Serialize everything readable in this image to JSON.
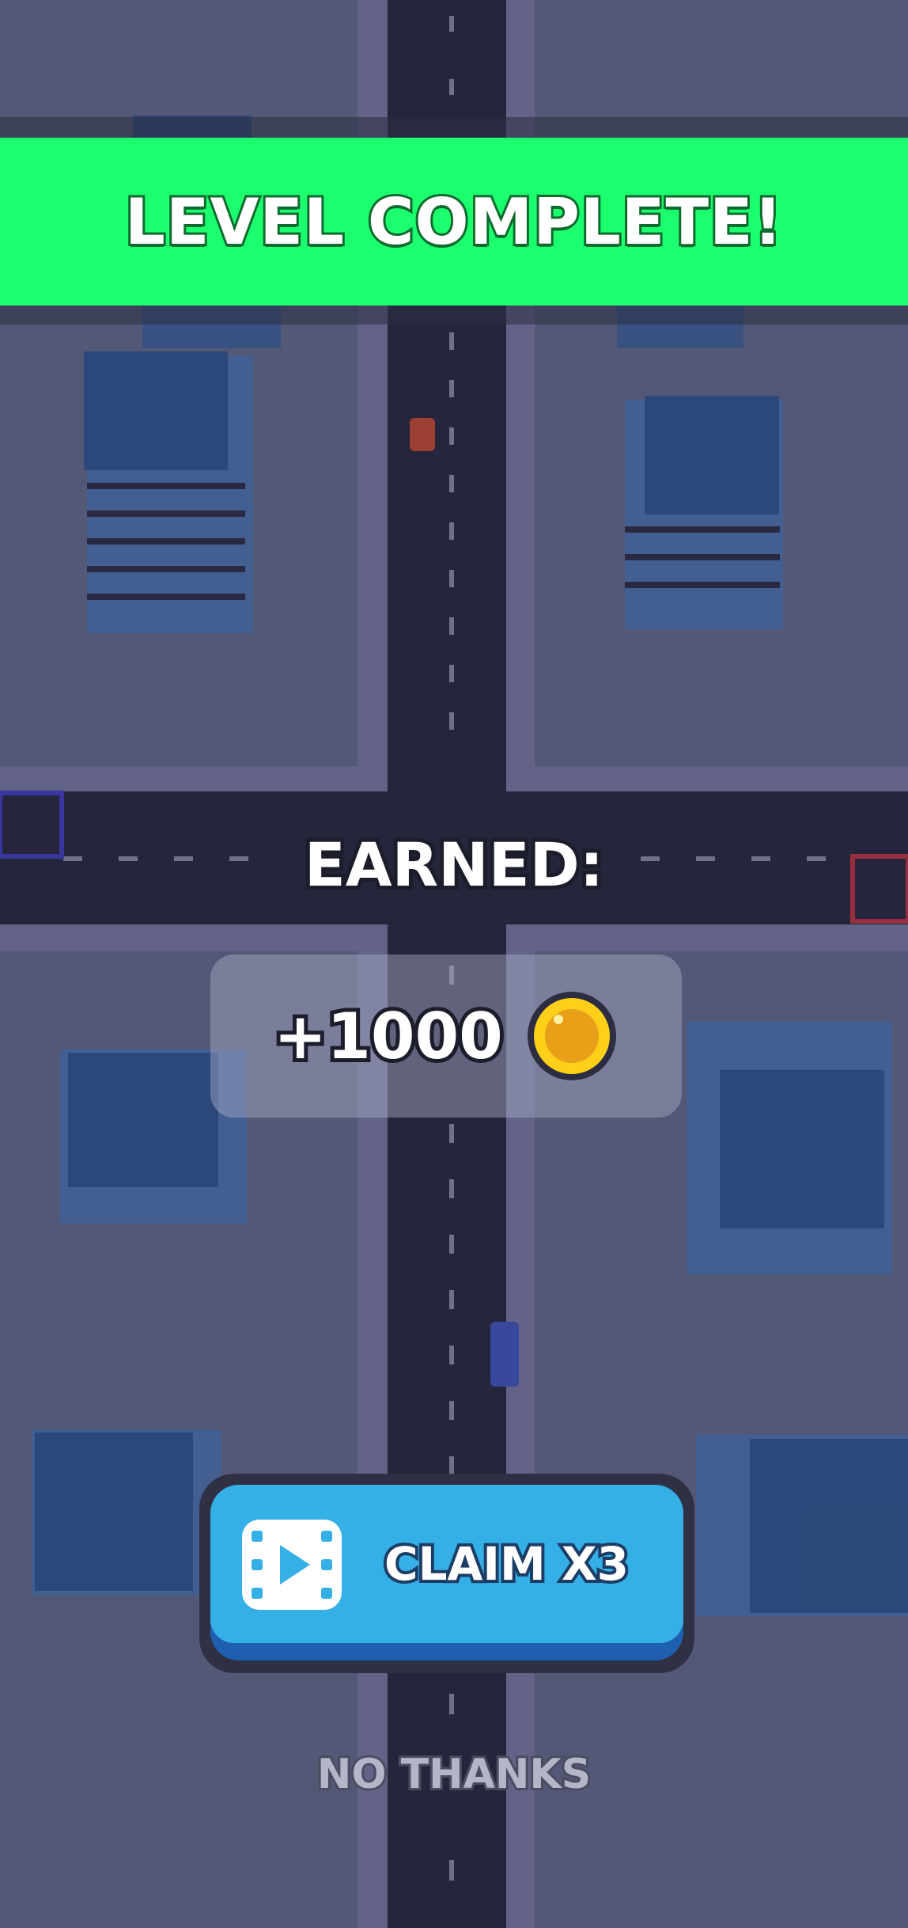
{
  "banner": {
    "title": "LEVEL COMPLETE!",
    "color": "#1cff6e"
  },
  "reward": {
    "label": "EARNED:",
    "amount": "+1000",
    "currency_icon": "coin-icon"
  },
  "claim_button": {
    "label": "CLAIM X3",
    "icon": "video-icon",
    "color": "#35b0e6"
  },
  "dismiss": {
    "label": "NO THANKS"
  }
}
